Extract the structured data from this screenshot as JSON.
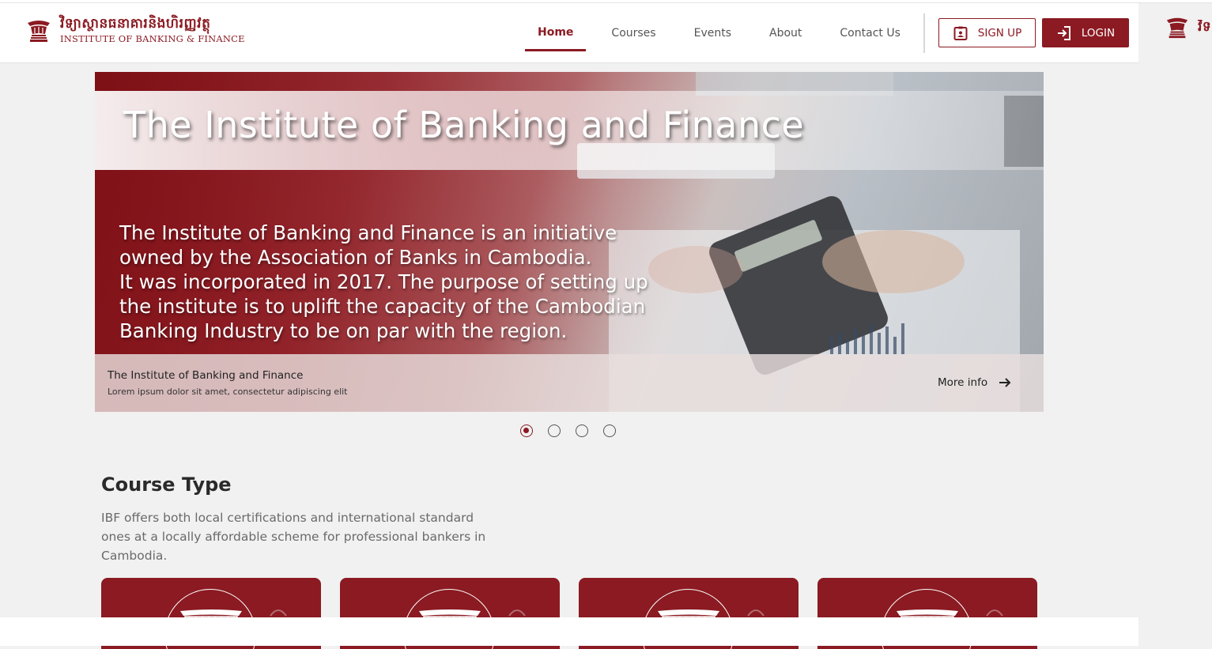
{
  "header": {
    "logo_kh": "វិទ្យាស្ថានធនាគារនិងហិរញ្ញវត្ថុ",
    "logo_en": "INSTITUTE OF BANKING & FINANCE",
    "nav": [
      {
        "label": "Home",
        "active": true
      },
      {
        "label": "Courses",
        "active": false
      },
      {
        "label": "Events",
        "active": false
      },
      {
        "label": "About",
        "active": false
      },
      {
        "label": "Contact Us",
        "active": false
      }
    ],
    "signup_label": "SIGN UP",
    "login_label": "LOGIN",
    "signup_icon": "id-card-icon",
    "login_icon": "login-arrow-icon",
    "ghost_logo_text": "វិទ"
  },
  "hero": {
    "title": "The Institute of Banking and Finance",
    "body": [
      "The Institute of Banking and Finance is an initiative",
      "owned by the Association of Banks in Cambodia.",
      "It was incorporated in 2017. The purpose of setting up",
      "the institute is to uplift the capacity of the Cambodian",
      "Banking Industry to be on par with the region."
    ],
    "caption_title": "The Institute of Banking and Finance",
    "caption_sub": "Lorem ipsum dolor sit amet, consectetur adipiscing elit",
    "more_info": "More info",
    "slides": 4,
    "active_slide": 1
  },
  "course_type": {
    "title": "Course Type",
    "description": "IBF offers both local certifications and international standard ones at a locally affordable scheme for professional bankers in Cambodia.",
    "cards": 4
  },
  "colors": {
    "brand": "#8b1a22",
    "background": "#f1f1f1"
  }
}
